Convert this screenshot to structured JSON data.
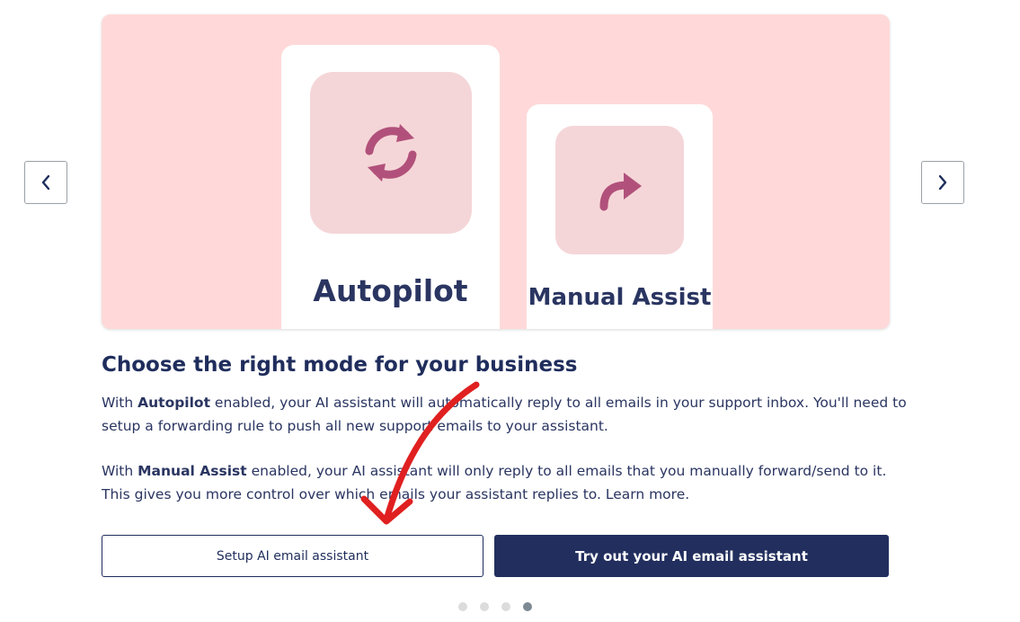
{
  "carousel": {
    "prev_icon": "chevron-left-icon",
    "next_icon": "chevron-right-icon",
    "slide": {
      "background_color": "#ffd9d9",
      "cards": [
        {
          "title": "Autopilot",
          "icon": "refresh-icon",
          "icon_color": "#b1517b"
        },
        {
          "title": "Manual Assist",
          "icon": "forward-arrow-icon",
          "icon_color": "#b1517b"
        }
      ]
    },
    "dots": {
      "count": 4,
      "active_index": 3
    }
  },
  "content": {
    "heading": "Choose the right mode for your business",
    "para1": {
      "pre": "With ",
      "bold": "Autopilot",
      "post": " enabled, your AI assistant will automatically reply to all emails in your support inbox. You'll need to setup a forwarding rule to push all new support emails to your assistant."
    },
    "para2": {
      "pre": "With ",
      "bold": "Manual Assist",
      "post": " enabled, your AI assistant will only reply to all emails that you manually forward/send to it. This gives you more control over which emails your assistant replies to. Learn more."
    }
  },
  "buttons": {
    "setup_label": "Setup AI email assistant",
    "try_label": "Try out your AI email assistant"
  },
  "colors": {
    "primary": "#222f5e",
    "annotation_arrow": "#e02020"
  }
}
